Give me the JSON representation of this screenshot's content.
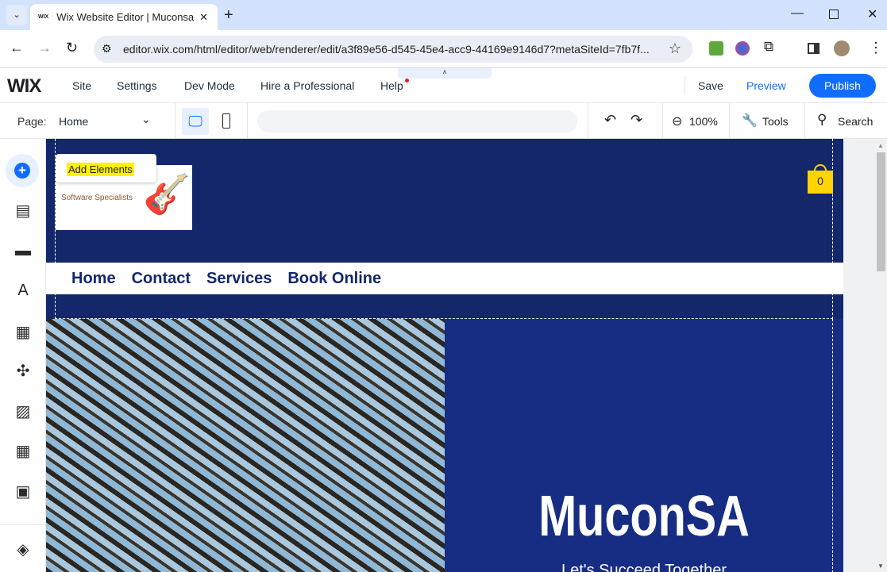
{
  "browser": {
    "tab_title": "Wix Website Editor | Muconsa",
    "url": "editor.wix.com/html/editor/web/renderer/edit/a3f89e56-d545-45e4-acc9-44169e9146d7?metaSiteId=7fb7f..."
  },
  "topbar": {
    "logo": "WIX",
    "menu": [
      "Site",
      "Settings",
      "Dev Mode",
      "Hire a Professional",
      "Help"
    ],
    "save": "Save",
    "preview": "Preview",
    "publish": "Publish"
  },
  "toolbar": {
    "page_label": "Page:",
    "page_value": "Home",
    "zoom": "100%",
    "tools": "Tools",
    "search": "Search"
  },
  "tooltip": "Add Elements",
  "site": {
    "logo_tagline": "Software Specialists",
    "cart_count": "0",
    "nav": [
      "Home",
      "Contact",
      "Services",
      "Book Online"
    ],
    "hero_title": "MuconSA",
    "hero_subtitle": "Let's Succeed Together"
  },
  "colors": {
    "accent": "#116dff",
    "header": "#14276b",
    "hero": "#162d83"
  }
}
